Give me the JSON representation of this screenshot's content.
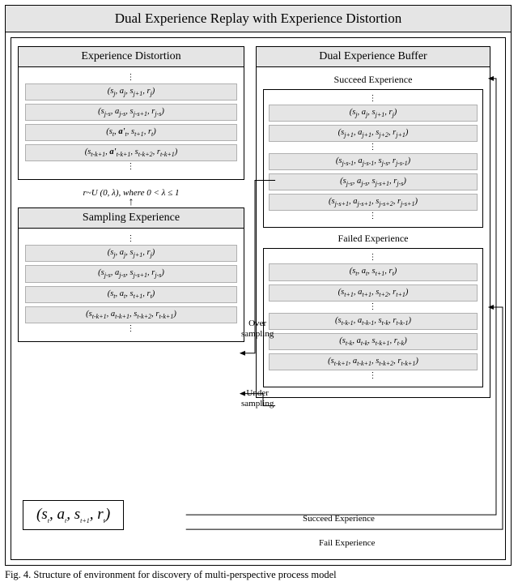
{
  "title": "Dual Experience Replay with Experience Distortion",
  "left": {
    "distortion": {
      "title": "Experience Distortion",
      "rows": [
        "(s_j, a_j, s_{j+1}, r_j)",
        "(s_{j-s}, a_{j-s}, s_{j-s+1}, r_{j-s})",
        "(s_t, a'_t, s_{t+1}, r_t)",
        "(s_{t-k+1}, a'_{t-k+1}, s_{t-k+2}, r_{t-k+1})"
      ]
    },
    "lambda_line": "r~U (0, λ), where 0 < λ ≤ 1",
    "sampling": {
      "title": "Sampling Experience",
      "rows": [
        "(s_j, a_j, s_{j+1}, r_j)",
        "(s_{j-s}, a_{j-s}, s_{j-s+1}, r_{j-s})",
        "(s_t, a_t, s_{t+1}, r_t)",
        "(s_{t-k+1}, a_{t-k+1}, s_{t-k+2}, r_{t-k+1})"
      ]
    }
  },
  "right": {
    "title": "Dual Experience Buffer",
    "succeed": {
      "title": "Succeed Experience",
      "rows": [
        "(s_j, a_j, s_{j+1}, r_j)",
        "(s_{j+1}, a_{j+1}, s_{j+2}, r_{j+1})",
        "(s_{j-s-1}, a_{j-s-1}, s_{j-s}, r_{j-s-1})",
        "(s_{j-s}, a_{j-s}, s_{j-s+1}, r_{j-s})",
        "(s_{j-s+1}, a_{j-s+1}, s_{j-s+2}, r_{j-s+1})"
      ]
    },
    "failed": {
      "title": "Failed Experience",
      "rows": [
        "(s_t, a_t, s_{t+1}, r_t)",
        "(s_{t+1}, a_{t+1}, s_{t+2}, r_{t+1})",
        "(s_{t-k-1}, a_{t-k-1}, s_{t-k}, r_{t-k-1})",
        "(s_{t-k}, a_{t-k}, s_{t-k+1}, r_{t-k})",
        "(s_{t-k+1}, a_{t-k+1}, s_{t-k+2}, r_{t-k+1})"
      ]
    }
  },
  "labels": {
    "over": "Over\nsampling",
    "under": "Under\nsampling",
    "succeed_exp": "Succeed Experience",
    "fail_exp": "Fail Experience"
  },
  "bottom_tuple": "(s_t, a_t, s_{t+1}, r_t)",
  "caption": "Fig. 4. Structure of environment for discovery of multi-perspective process model"
}
